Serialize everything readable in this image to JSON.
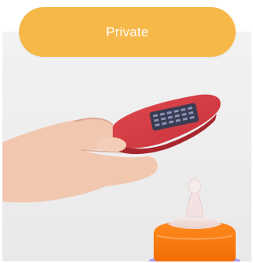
{
  "filter_button": {
    "label": "Private",
    "color": "#f7b84a"
  },
  "photo": {
    "subject": "hand-holding-phone-over-baby-bottle"
  }
}
